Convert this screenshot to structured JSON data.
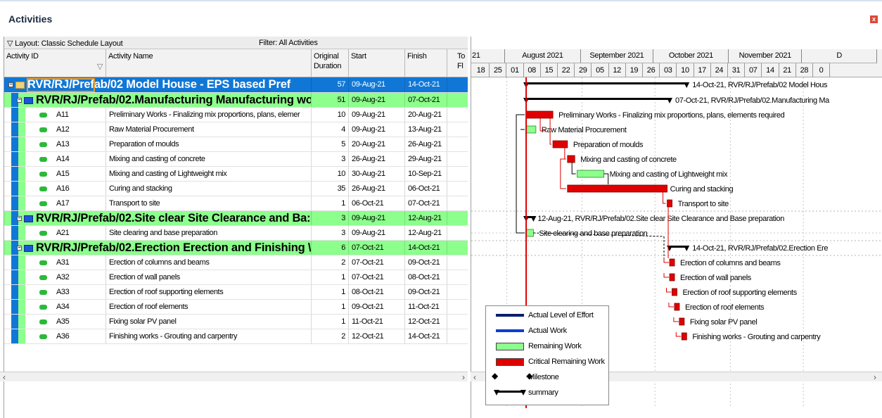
{
  "window": {
    "title": "Activities",
    "close_label": "x"
  },
  "grid": {
    "layout_label": "▽ Layout: Classic Schedule Layout",
    "filter_label": "Filter: All Activities",
    "columns": {
      "activity_id": "Activity ID",
      "activity_name": "Activity Name",
      "orig_duration_1": "Original",
      "orig_duration_2": "Duration",
      "start": "Start",
      "finish": "Finish",
      "total_float_1": "To",
      "total_float_2": "Fl"
    },
    "rows": [
      {
        "type": "wbs0",
        "id": "RVR/RJ/Prefab/02  Model House - EPS based Pref",
        "name": "",
        "dur": "57",
        "start": "09-Aug-21",
        "finish": "14-Oct-21"
      },
      {
        "type": "wbs1",
        "id": "RVR/RJ/Prefab/02.Manufacturing  Manufacturing wo",
        "name": "",
        "dur": "51",
        "start": "09-Aug-21",
        "finish": "07-Oct-21"
      },
      {
        "type": "act",
        "id": "A11",
        "name": "Preliminary Works - Finalizing mix proportions, plans, elemer",
        "dur": "10",
        "start": "09-Aug-21",
        "finish": "20-Aug-21"
      },
      {
        "type": "act",
        "id": "A12",
        "name": "Raw Material Procurement",
        "dur": "4",
        "start": "09-Aug-21",
        "finish": "13-Aug-21"
      },
      {
        "type": "act",
        "id": "A13",
        "name": "Preparation of moulds",
        "dur": "5",
        "start": "20-Aug-21",
        "finish": "26-Aug-21"
      },
      {
        "type": "act",
        "id": "A14",
        "name": "Mixing and casting of concrete",
        "dur": "3",
        "start": "26-Aug-21",
        "finish": "29-Aug-21"
      },
      {
        "type": "act",
        "id": "A15",
        "name": "Mixing and casting of Lightweight mix",
        "dur": "10",
        "start": "30-Aug-21",
        "finish": "10-Sep-21"
      },
      {
        "type": "act",
        "id": "A16",
        "name": "Curing and stacking",
        "dur": "35",
        "start": "26-Aug-21",
        "finish": "06-Oct-21"
      },
      {
        "type": "act",
        "id": "A17",
        "name": "Transport to site",
        "dur": "1",
        "start": "06-Oct-21",
        "finish": "07-Oct-21"
      },
      {
        "type": "wbs1",
        "id": "RVR/RJ/Prefab/02.Site clear  Site Clearance and Ba:",
        "name": "",
        "dur": "3",
        "start": "09-Aug-21",
        "finish": "12-Aug-21"
      },
      {
        "type": "act",
        "id": "A21",
        "name": "Site clearing and base preparation",
        "dur": "3",
        "start": "09-Aug-21",
        "finish": "12-Aug-21"
      },
      {
        "type": "wbs1",
        "id": "RVR/RJ/Prefab/02.Erection  Erection and Finishing \\",
        "name": "",
        "dur": "6",
        "start": "07-Oct-21",
        "finish": "14-Oct-21"
      },
      {
        "type": "act",
        "id": "A31",
        "name": "Erection of columns and beams",
        "dur": "2",
        "start": "07-Oct-21",
        "finish": "09-Oct-21"
      },
      {
        "type": "act",
        "id": "A32",
        "name": "Erection of wall panels",
        "dur": "1",
        "start": "07-Oct-21",
        "finish": "08-Oct-21"
      },
      {
        "type": "act",
        "id": "A33",
        "name": "Erection of roof supporting elements",
        "dur": "1",
        "start": "08-Oct-21",
        "finish": "09-Oct-21"
      },
      {
        "type": "act",
        "id": "A34",
        "name": "Erection of roof elements",
        "dur": "1",
        "start": "09-Oct-21",
        "finish": "11-Oct-21"
      },
      {
        "type": "act",
        "id": "A35",
        "name": "Fixing solar PV panel",
        "dur": "1",
        "start": "11-Oct-21",
        "finish": "12-Oct-21"
      },
      {
        "type": "act",
        "id": "A36",
        "name": "Finishing works - Grouting and carpentry",
        "dur": "2",
        "start": "12-Oct-21",
        "finish": "14-Oct-21"
      }
    ]
  },
  "gantt": {
    "months": [
      "21",
      "August 2021",
      "September 2021",
      "October 2021",
      "November 2021",
      "D"
    ],
    "weeks": [
      "18",
      "25",
      "01",
      "08",
      "15",
      "22",
      "29",
      "05",
      "12",
      "19",
      "26",
      "03",
      "10",
      "17",
      "24",
      "31",
      "07",
      "14",
      "21",
      "28",
      "0"
    ],
    "labels": {
      "wbs0": "14-Oct-21, RVR/RJ/Prefab/02  Model Hous",
      "manuf": "07-Oct-21, RVR/RJ/Prefab/02.Manufacturing  Ma",
      "a11": "Preliminary Works - Finalizing mix proportions, plans, elements required",
      "a12": "Raw Material Procurement",
      "a13": "Preparation of moulds",
      "a14": "Mixing and casting of concrete",
      "a15": "Mixing and casting of Lightweight mix",
      "a16": "Curing and stacking",
      "a17": "Transport to site",
      "site": "12-Aug-21, RVR/RJ/Prefab/02.Site clear  Site Clearance and Base preparation",
      "a21": "Site clearing and base preparation",
      "erection": "14-Oct-21, RVR/RJ/Prefab/02.Erection  Ere",
      "a31": "Erection of columns and beams",
      "a32": "Erection of wall panels",
      "a33": "Erection of roof supporting elements",
      "a34": "Erection of roof elements",
      "a35": "Fixing solar PV panel",
      "a36": "Finishing works - Grouting and carpentry"
    },
    "legend": [
      {
        "label": "Actual Level of Effort",
        "color": "#0a1e6e"
      },
      {
        "label": "Actual Work",
        "color": "#0a3cd6"
      },
      {
        "label": "Remaining Work",
        "color": "#8cff8c"
      },
      {
        "label": "Critical Remaining Work",
        "color": "#e00000"
      },
      {
        "label": "Milestone",
        "color": "#000000"
      },
      {
        "label": "summary",
        "color": "#000000"
      }
    ]
  },
  "colors": {
    "wbs0": "#1077d6",
    "wbs1": "#8cff8c",
    "critical": "#e00000",
    "remaining": "#8cff8c",
    "datadate": "#e00000"
  }
}
